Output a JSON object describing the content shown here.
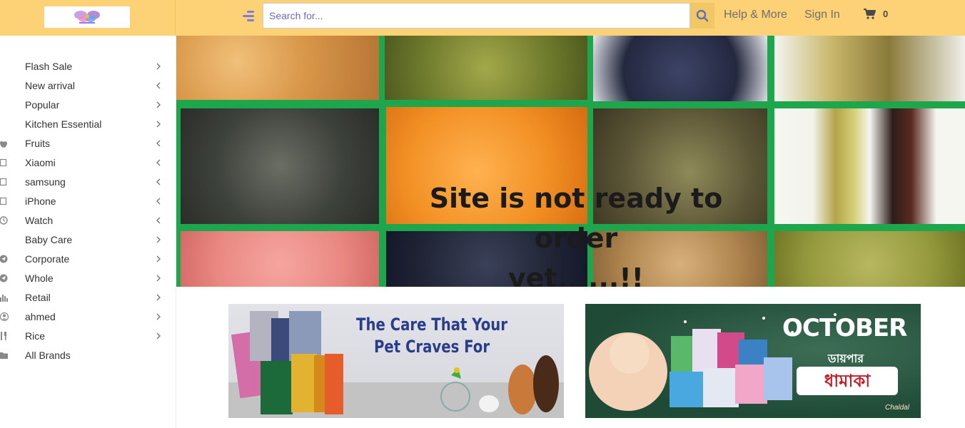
{
  "header": {
    "search_placeholder": "Search for...",
    "help_label": "Help & More",
    "signin_label": "Sign In",
    "cart_count": "0"
  },
  "sidebar": {
    "items": [
      {
        "label": "Flash Sale",
        "icon": "none",
        "chevron": "right"
      },
      {
        "label": "New arrival",
        "icon": "none",
        "chevron": "left"
      },
      {
        "label": "Popular",
        "icon": "none",
        "chevron": "right"
      },
      {
        "label": "Kitchen Essential",
        "icon": "none",
        "chevron": "right"
      },
      {
        "label": "Fruits",
        "icon": "apple-icon",
        "chevron": "left"
      },
      {
        "label": "Xiaomi",
        "icon": "square-icon",
        "chevron": "left"
      },
      {
        "label": "samsung",
        "icon": "square-icon",
        "chevron": "left"
      },
      {
        "label": "iPhone",
        "icon": "square-icon",
        "chevron": "left"
      },
      {
        "label": "Watch",
        "icon": "clock-icon",
        "chevron": "left"
      },
      {
        "label": "Baby Care",
        "icon": "none",
        "chevron": "right"
      },
      {
        "label": "Corporate",
        "icon": "send-icon",
        "chevron": "right"
      },
      {
        "label": "Whole",
        "icon": "send-icon",
        "chevron": "right"
      },
      {
        "label": "Retail",
        "icon": "bar-chart-icon",
        "chevron": "right"
      },
      {
        "label": "ahmed",
        "icon": "user-icon",
        "chevron": "right"
      },
      {
        "label": "Rice",
        "icon": "utensils-icon",
        "chevron": "right"
      },
      {
        "label": "All Brands",
        "icon": "folder-icon",
        "chevron": "none"
      }
    ]
  },
  "hero": {
    "message_line1": "Site is not ready to order",
    "message_line2": "yet......!!"
  },
  "banners": {
    "pet": {
      "line1": "The Care That Your",
      "line2": "Pet Craves For"
    },
    "october": {
      "title": "OCTOBER",
      "subtitle": "ডায়পার",
      "headline": "ধামাকা",
      "brand": "Chaldal"
    }
  },
  "colors": {
    "header_bg": "#fdd276",
    "accent": "#7c7ed8",
    "hero_grid": "#1da64b"
  }
}
